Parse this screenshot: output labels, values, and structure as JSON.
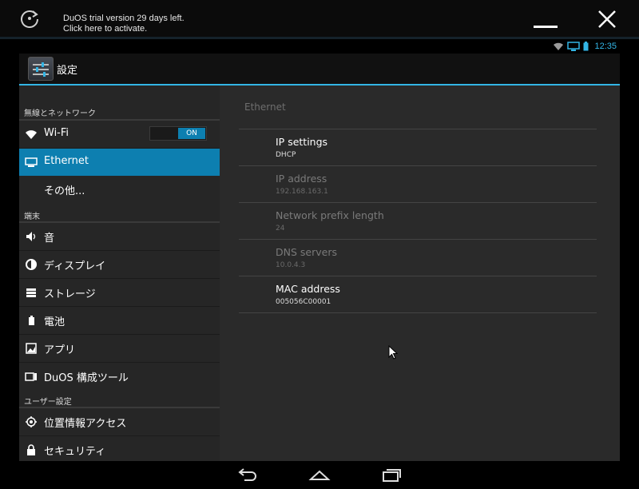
{
  "banner": {
    "trial_line1": "DuOS trial version 29 days left.",
    "trial_line2": "Click here to activate."
  },
  "statusbar": {
    "clock": "12:35"
  },
  "actionbar": {
    "title": "設定"
  },
  "sidebar": {
    "sections": [
      {
        "label": "無線とネットワーク"
      },
      {
        "label": "端末"
      },
      {
        "label": "ユーザー設定"
      }
    ],
    "items": [
      {
        "label": "Wi-Fi",
        "icon": "wifi-icon"
      },
      {
        "label": "Ethernet",
        "icon": "ethernet-icon",
        "selected": true
      },
      {
        "label": "その他..."
      },
      {
        "label": "音",
        "icon": "sound-icon"
      },
      {
        "label": "ディスプレイ",
        "icon": "display-icon"
      },
      {
        "label": "ストレージ",
        "icon": "storage-icon"
      },
      {
        "label": "電池",
        "icon": "battery-icon"
      },
      {
        "label": "アプリ",
        "icon": "apps-icon"
      },
      {
        "label": "DuOS 構成ツール",
        "icon": "duos-config-icon"
      },
      {
        "label": "位置情報アクセス",
        "icon": "location-icon"
      },
      {
        "label": "セキュリティ",
        "icon": "lock-icon"
      }
    ],
    "wifi_toggle": "ON"
  },
  "detail": {
    "header": "Ethernet",
    "prefs": [
      {
        "title": "IP settings",
        "summary": "DHCP",
        "enabled": true
      },
      {
        "title": "IP address",
        "summary": "192.168.163.1",
        "enabled": false
      },
      {
        "title": "Network prefix length",
        "summary": "24",
        "enabled": false
      },
      {
        "title": "DNS servers",
        "summary": "10.0.4.3",
        "enabled": false
      },
      {
        "title": "MAC address",
        "summary": "005056C00001",
        "enabled": true
      }
    ]
  },
  "colors": {
    "accent": "#33b5e5",
    "selected": "#0d7fb0"
  }
}
